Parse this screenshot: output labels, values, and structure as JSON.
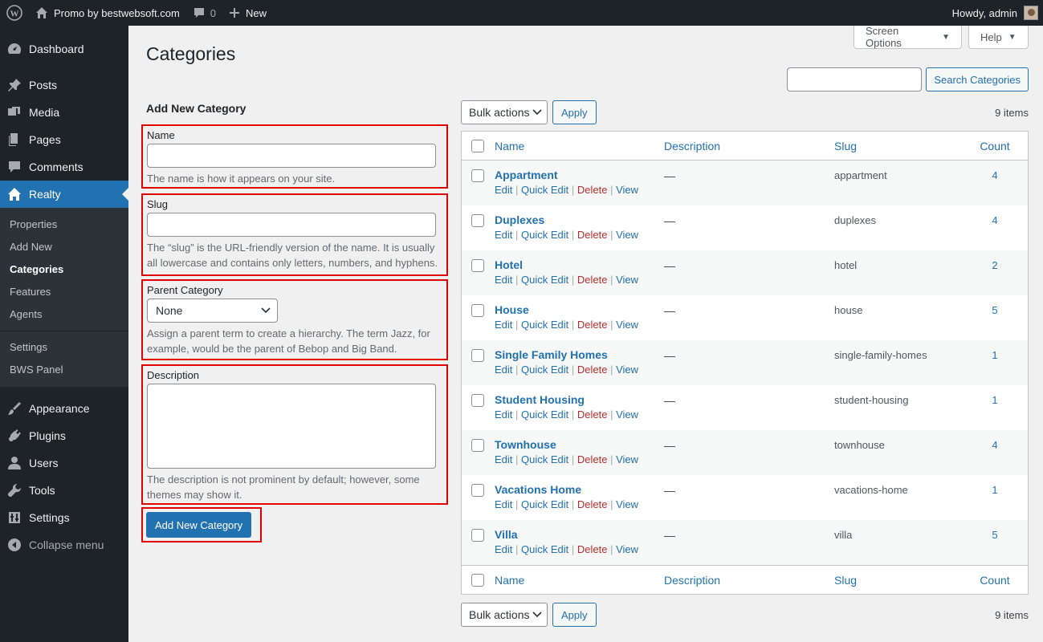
{
  "admin_bar": {
    "site_name": "Promo by bestwebsoft.com",
    "comments_count": "0",
    "new_label": "New",
    "howdy": "Howdy, admin"
  },
  "sidebar": {
    "items_top": [
      {
        "label": "Dashboard",
        "icon": "dashboard-icon"
      },
      {
        "label": "Posts",
        "icon": "pin-icon"
      },
      {
        "label": "Media",
        "icon": "media-icon"
      },
      {
        "label": "Pages",
        "icon": "pages-icon"
      },
      {
        "label": "Comments",
        "icon": "comment-icon"
      },
      {
        "label": "Realty",
        "icon": "home-icon"
      }
    ],
    "submenu": [
      "Properties",
      "Add New",
      "Categories",
      "Features",
      "Agents",
      "Settings",
      "BWS Panel"
    ],
    "items_bottom": [
      {
        "label": "Appearance",
        "icon": "brush-icon"
      },
      {
        "label": "Plugins",
        "icon": "plug-icon"
      },
      {
        "label": "Users",
        "icon": "user-icon"
      },
      {
        "label": "Tools",
        "icon": "wrench-icon"
      },
      {
        "label": "Settings",
        "icon": "settings-icon"
      },
      {
        "label": "Collapse menu",
        "icon": "collapse-icon"
      }
    ]
  },
  "screen_options": "Screen Options",
  "help": "Help",
  "page_title": "Categories",
  "search": {
    "button": "Search Categories",
    "value": ""
  },
  "form": {
    "title": "Add New Category",
    "name_label": "Name",
    "name_hint": "The name is how it appears on your site.",
    "slug_label": "Slug",
    "slug_hint": "The “slug” is the URL-friendly version of the name. It is usually all lowercase and contains only letters, numbers, and hyphens.",
    "parent_label": "Parent Category",
    "parent_value": "None",
    "parent_hint": "Assign a parent term to create a hierarchy. The term Jazz, for example, would be the parent of Bebop and Big Band.",
    "desc_label": "Description",
    "desc_hint": "The description is not prominent by default; however, some themes may show it.",
    "submit": "Add New Category"
  },
  "tablenav": {
    "bulk": "Bulk actions",
    "apply": "Apply",
    "items": "9 items"
  },
  "table": {
    "headers": {
      "name": "Name",
      "description": "Description",
      "slug": "Slug",
      "count": "Count"
    },
    "actions": {
      "edit": "Edit",
      "quick_edit": "Quick Edit",
      "delete": "Delete",
      "view": "View"
    },
    "rows": [
      {
        "name": "Appartment",
        "description": "—",
        "slug": "appartment",
        "count": "4"
      },
      {
        "name": "Duplexes",
        "description": "—",
        "slug": "duplexes",
        "count": "4"
      },
      {
        "name": "Hotel",
        "description": "—",
        "slug": "hotel",
        "count": "2"
      },
      {
        "name": "House",
        "description": "—",
        "slug": "house",
        "count": "5"
      },
      {
        "name": "Single Family Homes",
        "description": "—",
        "slug": "single-family-homes",
        "count": "1"
      },
      {
        "name": "Student Housing",
        "description": "—",
        "slug": "student-housing",
        "count": "1"
      },
      {
        "name": "Townhouse",
        "description": "—",
        "slug": "townhouse",
        "count": "4"
      },
      {
        "name": "Vacations Home",
        "description": "—",
        "slug": "vacations-home",
        "count": "1"
      },
      {
        "name": "Villa",
        "description": "—",
        "slug": "villa",
        "count": "5"
      }
    ]
  }
}
